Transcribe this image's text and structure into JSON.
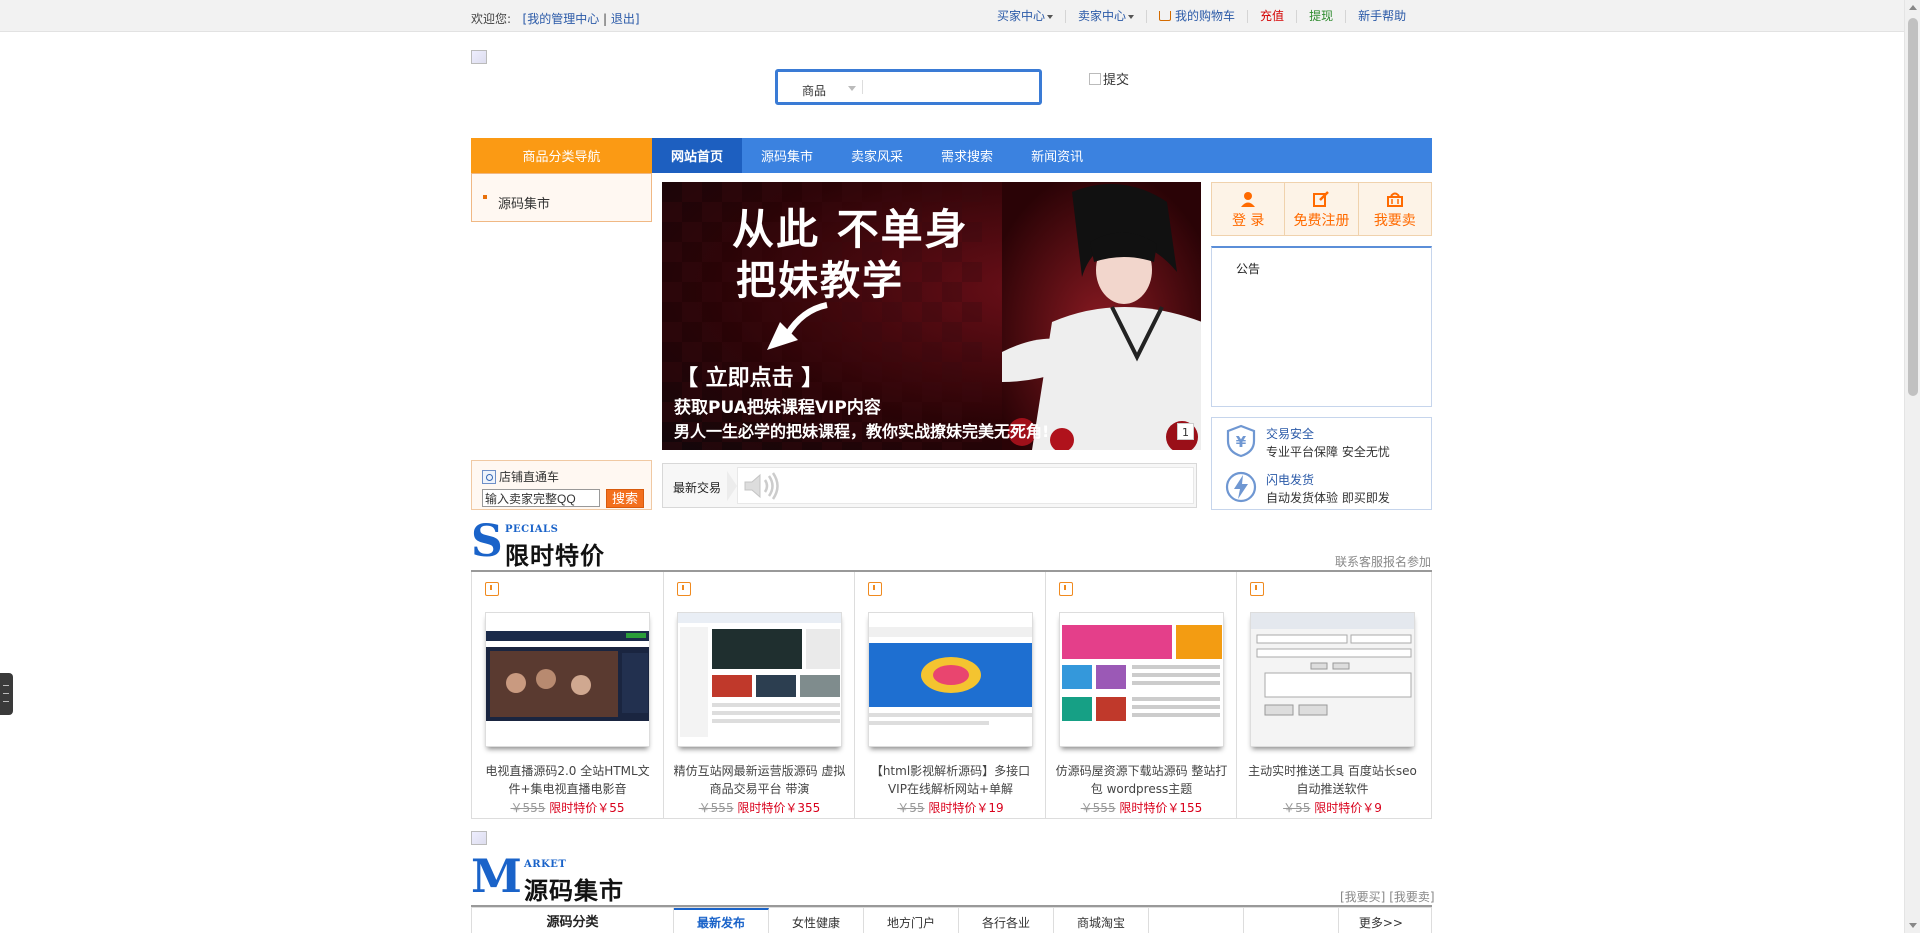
{
  "topbar": {
    "welcome": "欢迎您:",
    "bracket_open": "[",
    "my_admin": "我的管理中心",
    "separator": "|",
    "logout": "退出",
    "bracket_close": "]",
    "buyer_center": "买家中心",
    "seller_center": "卖家中心",
    "cart": "我的购物车",
    "recharge": "充值",
    "withdraw": "提现",
    "help": "新手帮助"
  },
  "search": {
    "category": "商品",
    "query": "",
    "submit_alt": "提交"
  },
  "nav": {
    "category_nav": "商品分类导航",
    "items": [
      "网站首页",
      "源码集市",
      "卖家风采",
      "需求搜索",
      "新闻资讯"
    ]
  },
  "left_category": {
    "item": "源码集市"
  },
  "banner": {
    "line1": "从此 不单身",
    "line2": "把妹教学",
    "line3": "【 立即点击 】",
    "line4": "获取PUA把妹课程VIP内容",
    "line5": "男人一生必学的把妹课程，教你实战撩妹完美无死角!",
    "page": "1"
  },
  "userbox": {
    "login": "登 录",
    "register": "免费注册",
    "sell": "我要卖"
  },
  "notice": {
    "title": "公告"
  },
  "guarantee": {
    "items": [
      {
        "title": "交易安全",
        "desc": "专业平台保障 安全无忧",
        "icon": "yen-shield-icon"
      },
      {
        "title": "闪电发货",
        "desc": "自动发货体验 即买即发",
        "icon": "lightning-icon"
      }
    ]
  },
  "store_search": {
    "title": "店铺直通车",
    "placeholder": "输入卖家完整QQ",
    "button": "搜索"
  },
  "latest": {
    "label": "最新交易"
  },
  "specials": {
    "letter": "S",
    "en": "PECIALS",
    "title": "限时特价",
    "link": "联系客服报名参加",
    "items": [
      {
        "name": "电视直播源码2.0 全站HTML文件+集电视直播电影音",
        "old": "￥555",
        "new": "限时特价￥55"
      },
      {
        "name": "精仿互站网最新运营版源码 虚拟商品交易平台 带演",
        "old": "￥555",
        "new": "限时特价￥355"
      },
      {
        "name": "【html影视解析源码】多接口VIP在线解析网站+单解",
        "old": "￥55",
        "new": "限时特价￥19"
      },
      {
        "name": "仿源码屋资源下载站源码 整站打包 wordpress主题",
        "old": "￥555",
        "new": "限时特价￥155"
      },
      {
        "name": "主动实时推送工具 百度站长seo自动推送软件",
        "old": "￥55",
        "new": "限时特价￥9"
      }
    ]
  },
  "market": {
    "letter": "M",
    "en": "ARKET",
    "title": "源码集市",
    "link_buy": "[我要买]",
    "link_sell": "[我要卖]",
    "category": "源码分类",
    "tabs": [
      "最新发布",
      "女性健康",
      "地方门户",
      "各行各业",
      "商城淘宝",
      "",
      ""
    ],
    "more": "更多>>"
  },
  "colors": {
    "nav_blue": "#3b82e0",
    "nav_orange": "#fb9a14",
    "accent_red": "#d9001b",
    "link_blue": "#2b5aa8"
  }
}
